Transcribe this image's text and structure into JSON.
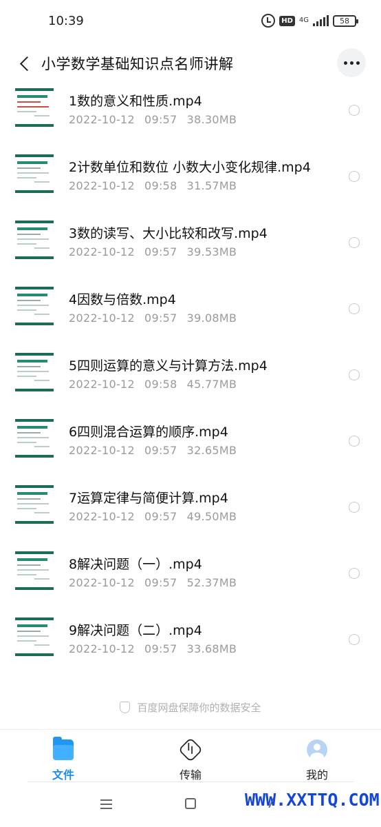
{
  "status": {
    "time": "10:39",
    "hd": "HD",
    "network": "4G",
    "battery": "58"
  },
  "header": {
    "title": "小学数学基础知识点名师讲解"
  },
  "files": [
    {
      "name": "1数的意义和性质.mp4",
      "date": "2022-10-12",
      "time": "09:57",
      "size": "38.30MB"
    },
    {
      "name": "2计数单位和数位 小数大小变化规律.mp4",
      "date": "2022-10-12",
      "time": "09:58",
      "size": "31.57MB"
    },
    {
      "name": "3数的读写、大小比较和改写.mp4",
      "date": "2022-10-12",
      "time": "09:57",
      "size": "39.53MB"
    },
    {
      "name": "4因数与倍数.mp4",
      "date": "2022-10-12",
      "time": "09:57",
      "size": "39.08MB"
    },
    {
      "name": "5四则运算的意义与计算方法.mp4",
      "date": "2022-10-12",
      "time": "09:58",
      "size": "45.77MB"
    },
    {
      "name": "6四则混合运算的顺序.mp4",
      "date": "2022-10-12",
      "time": "09:57",
      "size": "32.65MB"
    },
    {
      "name": "7运算定律与简便计算.mp4",
      "date": "2022-10-12",
      "time": "09:57",
      "size": "49.50MB"
    },
    {
      "name": "8解决问题（一）.mp4",
      "date": "2022-10-12",
      "time": "09:57",
      "size": "52.37MB"
    },
    {
      "name": "9解决问题（二）.mp4",
      "date": "2022-10-12",
      "time": "09:57",
      "size": "33.68MB"
    }
  ],
  "footer_note": "百度网盘保障你的数据安全",
  "tabs": [
    {
      "label": "文件",
      "icon": "folder-icon",
      "active": true
    },
    {
      "label": "传输",
      "icon": "transfer-icon",
      "active": false
    },
    {
      "label": "我的",
      "icon": "avatar-icon",
      "active": false
    }
  ],
  "watermark": "WWW.XXTTQ.COM",
  "colors": {
    "accent": "#1a8cf0",
    "thumb_header": "#1e6b5a",
    "meta_text": "#9a9a9a",
    "watermark": "#1446d8"
  }
}
